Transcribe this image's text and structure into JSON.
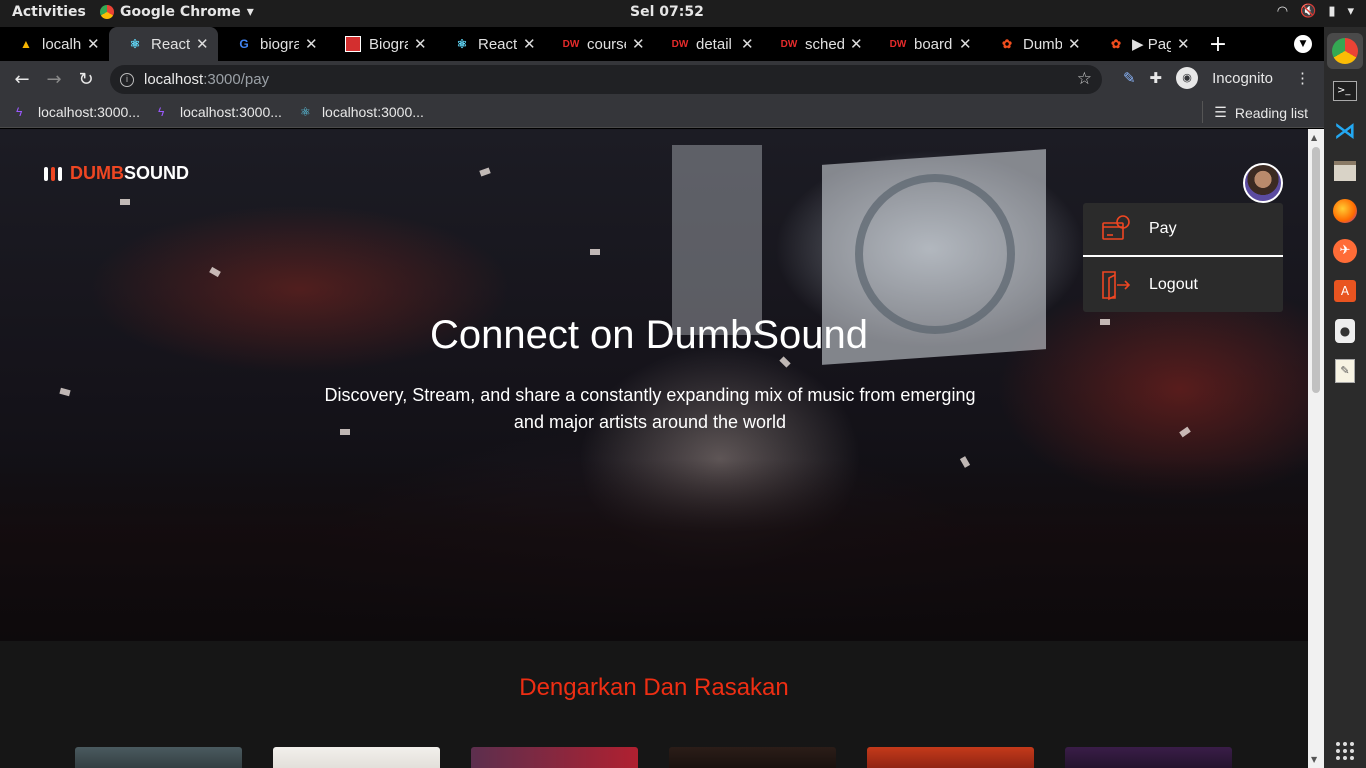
{
  "os": {
    "activities": "Activities",
    "app_name": "Google Chrome",
    "clock": "Sel 07:52"
  },
  "tabs": [
    {
      "title": "localhost",
      "icon": "vite-icon",
      "icon_color": "#f7b500"
    },
    {
      "title": "React App",
      "icon": "react-icon",
      "icon_color": "#61dafb",
      "active": true
    },
    {
      "title": "biografi",
      "icon": "google-icon",
      "icon_color": "#4285f4"
    },
    {
      "title": "Biografi",
      "icon": "news-icon",
      "icon_color": "#d32f2f"
    },
    {
      "title": "React-Bootstrap",
      "icon": "react-icon",
      "icon_color": "#61dafb"
    },
    {
      "title": "course",
      "icon": "dumbways-icon",
      "icon_color": "#e52b2b"
    },
    {
      "title": "detail",
      "icon": "dumbways-icon",
      "icon_color": "#e52b2b"
    },
    {
      "title": "schedule",
      "icon": "dumbways-icon",
      "icon_color": "#e52b2b"
    },
    {
      "title": "board",
      "icon": "dumbways-icon",
      "icon_color": "#e52b2b"
    },
    {
      "title": "DumbSound",
      "icon": "figma-icon",
      "icon_color": "#f24e1e"
    },
    {
      "title": "▶ Page",
      "icon": "figma-icon",
      "icon_color": "#f24e1e"
    }
  ],
  "toolbar": {
    "url_host": "localhost",
    "url_path": ":3000/pay",
    "incognito": "Incognito"
  },
  "bookmarks": [
    {
      "label": "localhost:3000...",
      "icon": "vite-icon"
    },
    {
      "label": "localhost:3000...",
      "icon": "vite-icon"
    },
    {
      "label": "localhost:3000...",
      "icon": "react-icon"
    }
  ],
  "reading_list": "Reading list",
  "page": {
    "logo_red": "DUMB",
    "logo_white": "SOUND",
    "menu": {
      "pay": "Pay",
      "logout": "Logout"
    },
    "hero_title": "Connect on DumbSound",
    "hero_subtitle": "Discovery, Stream, and share a constantly expanding mix of music from emerging and major artists around the world",
    "section_title": "Dengarkan Dan Rasakan",
    "accent_color": "#ee4622"
  },
  "dock": [
    "chrome-icon",
    "terminal-icon",
    "vscode-icon",
    "files-icon",
    "firefox-icon",
    "postman-icon",
    "software-center-icon",
    "dbeaver-icon",
    "text-editor-icon"
  ]
}
